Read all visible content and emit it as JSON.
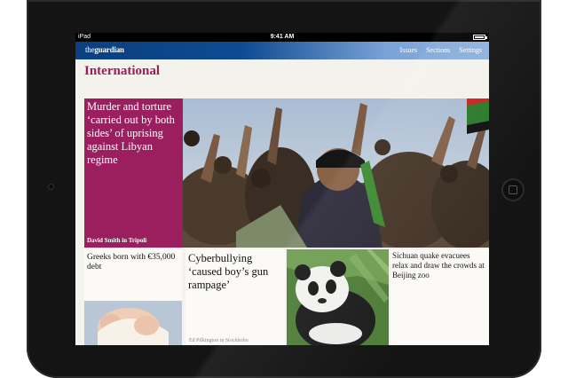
{
  "statusbar": {
    "carrier": "iPad",
    "time": "9:41 AM"
  },
  "navbar": {
    "logo_the": "the",
    "logo_guardian": "guardian",
    "links": [
      "Issues",
      "Sections",
      "Settings"
    ]
  },
  "section": {
    "title": "International"
  },
  "lead": {
    "headline": "Murder and torture ‘carried out by both sides’ of uprising against Libyan regime",
    "byline": "David Smith in Tripoli"
  },
  "stories": [
    {
      "headline": "Greeks born with €35,000 debt"
    },
    {
      "headline": "Cyberbullying ‘caused boy’s gun rampage’",
      "caption": "Ed Pilkington in Stockholm"
    },
    {
      "headline": ""
    },
    {
      "headline": "Sichuan quake evacuees relax and draw the crowds at Beijing zoo"
    }
  ]
}
